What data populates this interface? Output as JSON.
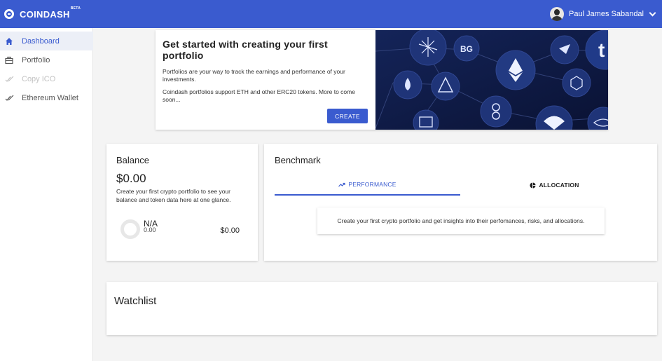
{
  "app": {
    "brand": "COINDASH",
    "beta": "BETA"
  },
  "user": {
    "name": "Paul James Sabandal"
  },
  "sidebar": {
    "items": [
      {
        "label": "Dashboard",
        "icon": "home-icon",
        "state": "active"
      },
      {
        "label": "Portfolio",
        "icon": "briefcase-icon",
        "state": "normal"
      },
      {
        "label": "Copy ICO",
        "icon": "check-double-icon",
        "state": "disabled"
      },
      {
        "label": "Ethereum Wallet",
        "icon": "check-double-icon",
        "state": "normal"
      }
    ]
  },
  "hero": {
    "title": "Get started with creating your first portfolio",
    "p1": "Portfolios are your way to track the earnings and performance of your investments.",
    "p2": "Coindash portfolios support ETH and other ERC20 tokens. More to come soon...",
    "button": "CREATE"
  },
  "balance": {
    "title": "Balance",
    "value": "$0.00",
    "desc": "Create your first crypto portfolio to see your balance and token data here at one glance.",
    "token_label": "N/A",
    "token_value": "0.00",
    "token_amount": "$0.00"
  },
  "benchmark": {
    "title": "Benchmark",
    "tabs": [
      {
        "label": "PERFORMANCE",
        "icon": "trending-up-icon",
        "state": "active"
      },
      {
        "label": "ALLOCATION",
        "icon": "pie-chart-icon",
        "state": "inactive"
      }
    ],
    "message": "Create your first crypto portfolio and get insights into their perfomances, risks, and allocations."
  },
  "watchlist": {
    "title": "Watchlist"
  },
  "colors": {
    "primary": "#3a5bcf",
    "hero_art_bg": "#0e1a44"
  }
}
